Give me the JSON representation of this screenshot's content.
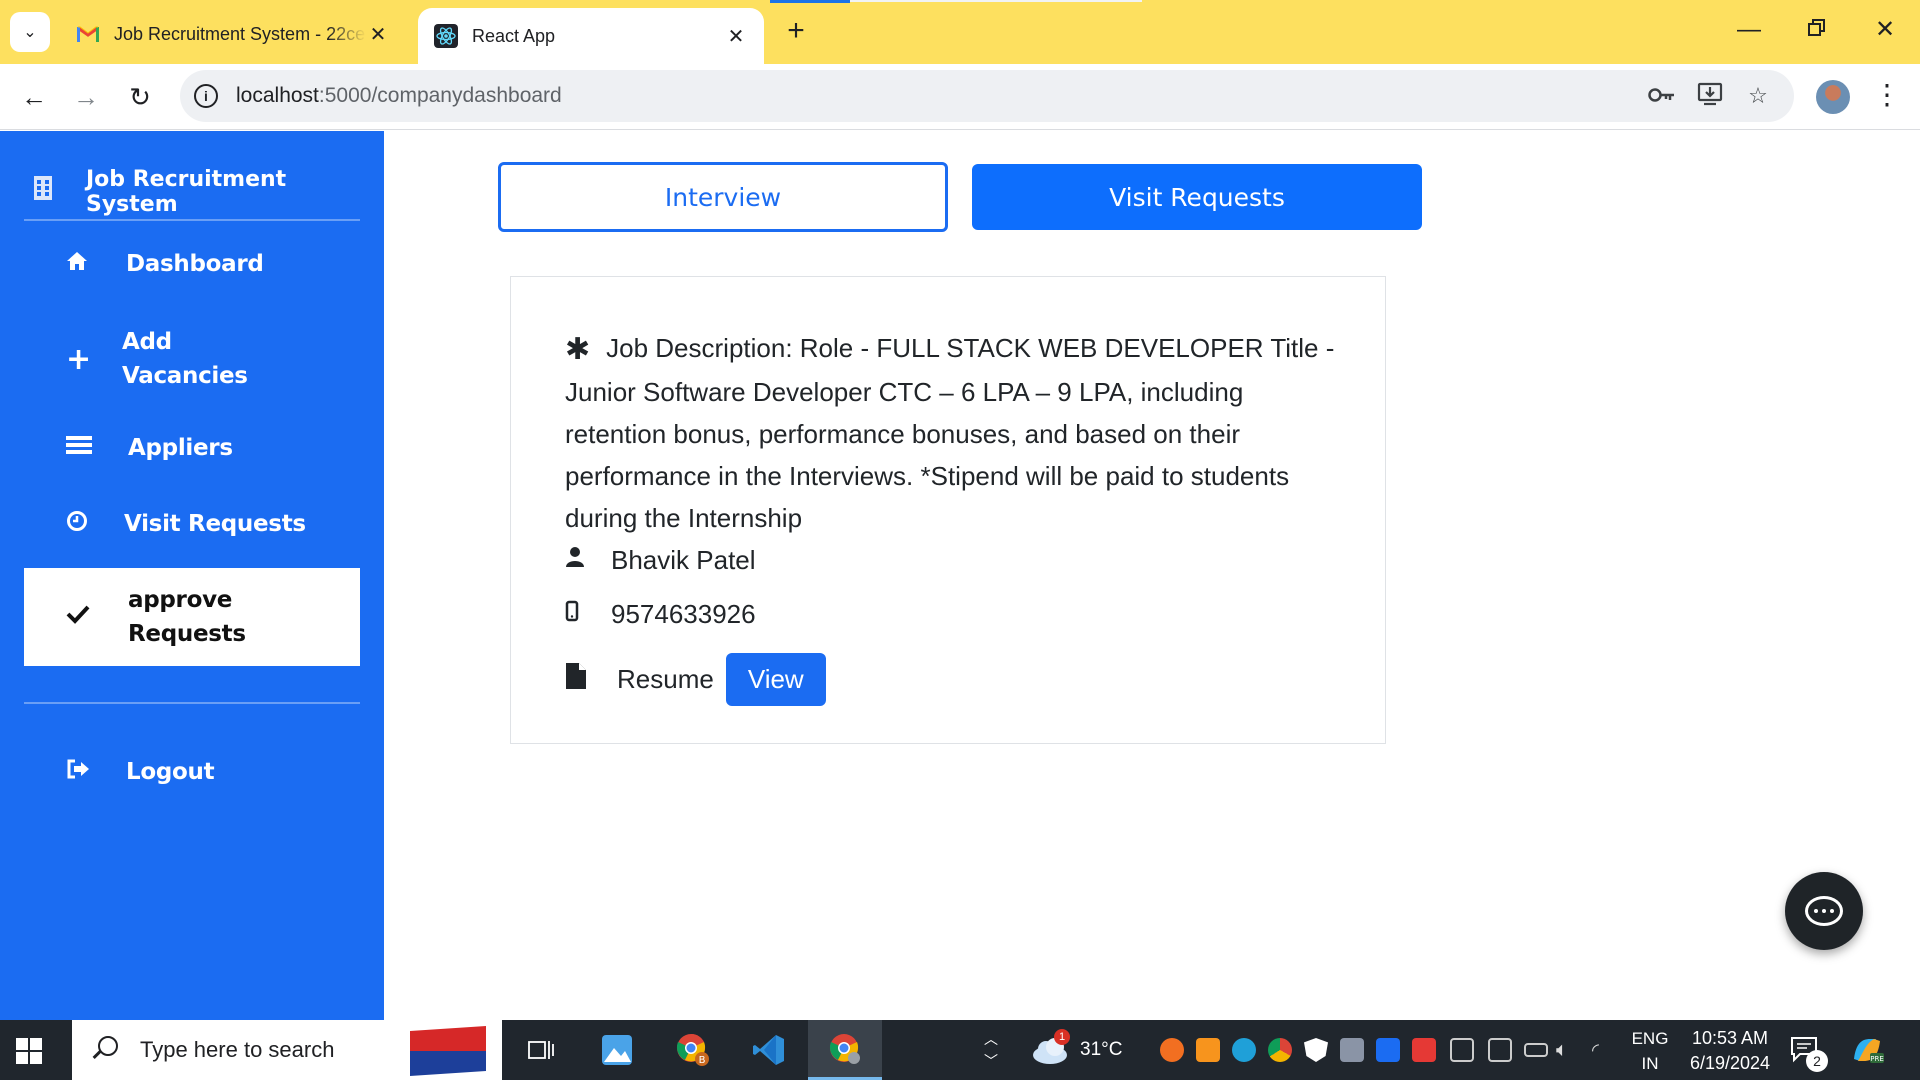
{
  "browser": {
    "tabs": [
      {
        "title": "Job Recruitment System - 22ce",
        "favicon": "gmail-icon",
        "active": false
      },
      {
        "title": "React App",
        "favicon": "react-icon",
        "active": true
      }
    ],
    "url_host": "localhost",
    "url_path": ":5000/companydashboard"
  },
  "sidebar": {
    "brand": "Job Recruitment System",
    "items": [
      {
        "label": "Dashboard",
        "icon": "home-icon"
      },
      {
        "label_line1": "Add",
        "label_line2": "Vacancies",
        "icon": "plus-icon"
      },
      {
        "label": "Appliers",
        "icon": "list-icon"
      },
      {
        "label": "Visit Requests",
        "icon": "clock-icon"
      },
      {
        "label_line1": "approve",
        "label_line2": "Requests",
        "icon": "check-icon",
        "active": true
      },
      {
        "label": "Logout",
        "icon": "logout-icon"
      }
    ]
  },
  "main": {
    "interview_label": "Interview",
    "visit_requests_label": "Visit Requests",
    "request": {
      "description": "Job Description: Role - FULL STACK WEB DEVELOPER Title - Junior Software Developer CTC – 6 LPA – 9 LPA, including retention bonus, performance bonuses, and based on their performance in the Interviews. *Stipend will be paid to students during the Internship",
      "name": "Bhavik Patel",
      "phone": "9574633926",
      "resume_label": "Resume",
      "view_label": "View"
    }
  },
  "taskbar": {
    "search_placeholder": "Type here to search",
    "weather_temp": "31°C",
    "weather_badge": "1",
    "lang_line1": "ENG",
    "lang_line2": "IN",
    "time": "10:53 AM",
    "date": "6/19/2024",
    "notification_count": "2"
  },
  "colors": {
    "sidebar": "#1b6cf2",
    "primary": "#0d6efd",
    "tabbar": "#fde05f",
    "taskbar": "#20262d"
  }
}
